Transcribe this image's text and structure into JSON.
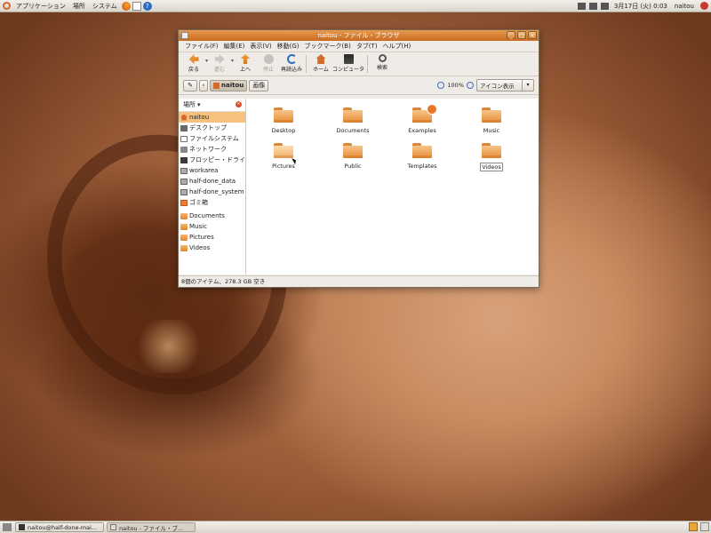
{
  "top_panel": {
    "menus": [
      "アプリケーション",
      "場所",
      "システム"
    ],
    "clock": "3月17日 (火)  0:03",
    "user": "naitou"
  },
  "window": {
    "title": "naitou - ファイル・ブラウザ",
    "menubar": [
      "ファイル(F)",
      "編集(E)",
      "表示(V)",
      "移動(G)",
      "ブックマーク(B)",
      "タブ(T)",
      "ヘルプ(H)"
    ],
    "toolbar": {
      "back": "戻る",
      "forward": "進む",
      "up": "上へ",
      "stop": "停止",
      "reload": "再読込み",
      "home": "ホーム",
      "computer": "コンピュータ",
      "search": "検索"
    },
    "location": {
      "current": "naitou",
      "next": "画像",
      "zoom": "100%",
      "view": "アイコン表示"
    },
    "sidebar": {
      "header": "場所",
      "places": [
        "naitou",
        "デスクトップ",
        "ファイルシステム",
        "ネットワーク",
        "フロッピー・ドライブ",
        "workarea",
        "half-done_data",
        "half-done_system",
        "ゴミ箱"
      ],
      "bookmarks": [
        "Documents",
        "Music",
        "Pictures",
        "Videos"
      ]
    },
    "files": [
      "Desktop",
      "Documents",
      "Examples",
      "Music",
      "Pictures",
      "Public",
      "Templates",
      "Videos"
    ],
    "status": "8個のアイテム、278.3 GB 空き"
  },
  "bottom_panel": {
    "tasks": [
      "naitou@half-done-mai...",
      "naitou - ファイル・ブ..."
    ]
  }
}
